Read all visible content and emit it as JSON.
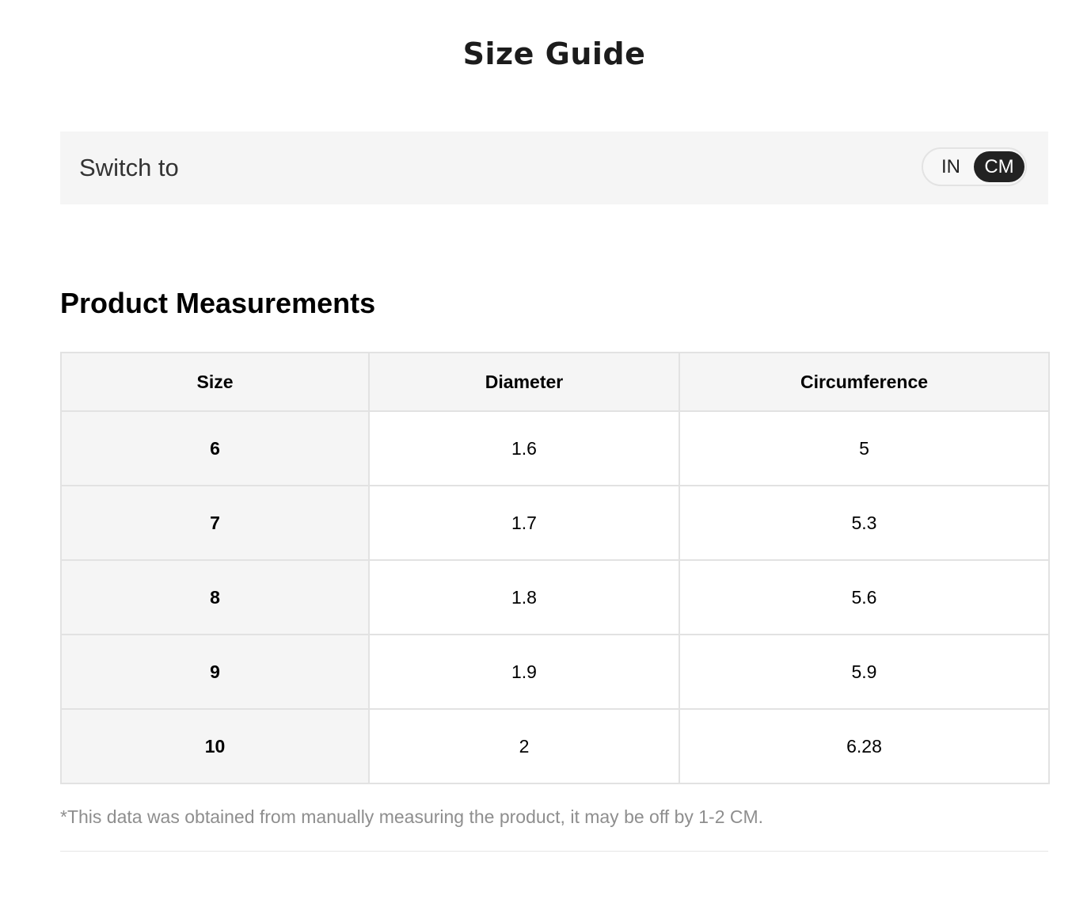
{
  "header": {
    "title": "Size Guide"
  },
  "unit_switch": {
    "label": "Switch to",
    "options": [
      "IN",
      "CM"
    ],
    "selected": "CM",
    "active_color": "#222222"
  },
  "measurements": {
    "heading": "Product Measurements",
    "columns": [
      "Size",
      "Diameter",
      "Circumference"
    ],
    "rows": [
      [
        "6",
        "1.6",
        "5"
      ],
      [
        "7",
        "1.7",
        "5.3"
      ],
      [
        "8",
        "1.8",
        "5.6"
      ],
      [
        "9",
        "1.9",
        "5.9"
      ],
      [
        "10",
        "2",
        "6.28"
      ]
    ],
    "footnote": "*This data was obtained from manually measuring the product, it may be off by 1-2 CM."
  }
}
